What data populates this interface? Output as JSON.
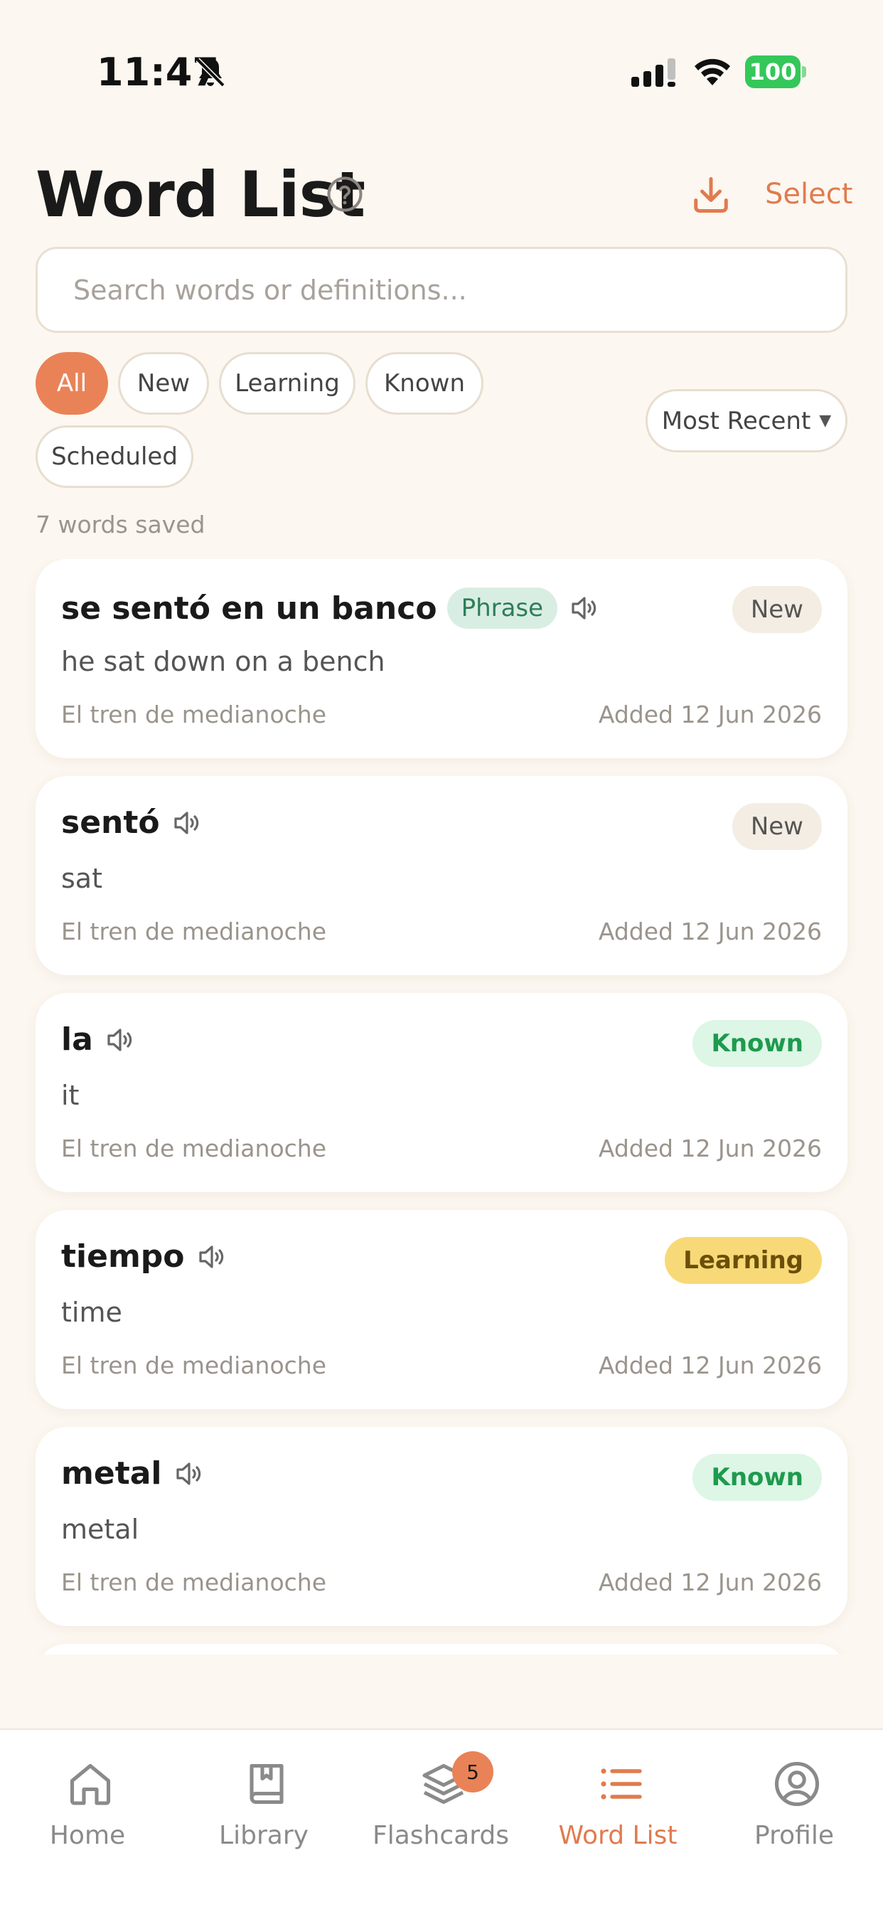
{
  "status_bar": {
    "time": "11:47",
    "battery": "100"
  },
  "header": {
    "title": "Word List",
    "select_label": "Select"
  },
  "search": {
    "placeholder": "Search words or definitions..."
  },
  "filters": {
    "chips": [
      "All",
      "New",
      "Learning",
      "Known",
      "Scheduled"
    ],
    "active": "All",
    "sort_label": "Most Recent"
  },
  "summary": {
    "count_text": "7 words saved"
  },
  "words": [
    {
      "word": "se sentó en un banco",
      "tag": "Phrase",
      "definition": "he sat down on a bench",
      "source": "El tren de medianoche",
      "added": "Added 12 Jun 2026",
      "status": "New"
    },
    {
      "word": "sentó",
      "definition": "sat",
      "source": "El tren de medianoche",
      "added": "Added 12 Jun 2026",
      "status": "New"
    },
    {
      "word": "la",
      "definition": "it",
      "source": "El tren de medianoche",
      "added": "Added 12 Jun 2026",
      "status": "Known"
    },
    {
      "word": "tiempo",
      "definition": "time",
      "source": "El tren de medianoche",
      "added": "Added 12 Jun 2026",
      "status": "Learning"
    },
    {
      "word": "metal",
      "definition": "metal",
      "source": "El tren de medianoche",
      "added": "Added 12 Jun 2026",
      "status": "Known"
    }
  ],
  "tabbar": {
    "items": [
      {
        "label": "Home",
        "icon": "home-icon"
      },
      {
        "label": "Library",
        "icon": "book-icon"
      },
      {
        "label": "Flashcards",
        "icon": "layers-icon",
        "badge": "5"
      },
      {
        "label": "Word List",
        "icon": "list-icon"
      },
      {
        "label": "Profile",
        "icon": "user-circle-icon"
      }
    ],
    "active": "Word List"
  },
  "colors": {
    "accent": "#E07B4F",
    "background": "#FCF7F0",
    "known": "#1E9A4E",
    "learning": "#F8D977"
  }
}
